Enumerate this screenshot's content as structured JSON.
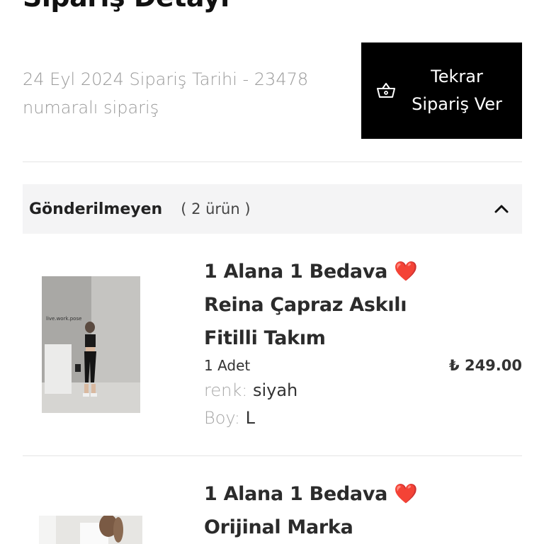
{
  "page": {
    "title": "Sipariş Detayı",
    "order_meta": "24 Eyl 2024 Sipariş Tarihi - 23478 numaralı sipariş",
    "reorder_label": "Tekrar Sipariş Ver"
  },
  "group": {
    "title": "Gönderilmeyen",
    "count": "( 2 ürün )"
  },
  "products": [
    {
      "name": "1 Alana 1 Bedava",
      "name_rest": "Reina Çapraz Askılı Fitilli Takım",
      "heart": "❤️",
      "quantity": "1 Adet",
      "price": "₺ 249.00",
      "color_key": "renk:",
      "color_value": "siyah",
      "size_key": "Boy:",
      "size_value": "L",
      "photo_text": "live.work.pose"
    },
    {
      "name": "1 Alana 1 Bedava",
      "name_rest": "Orijinal Marka",
      "heart": "❤️"
    }
  ],
  "colors": {
    "button_bg": "#000000",
    "group_bg": "#f4f4f5",
    "muted_text": "#9a9a9a",
    "heart": "#e0242f"
  },
  "icons": {
    "basket": "basket-icon",
    "chevron": "chevron-up-icon"
  }
}
